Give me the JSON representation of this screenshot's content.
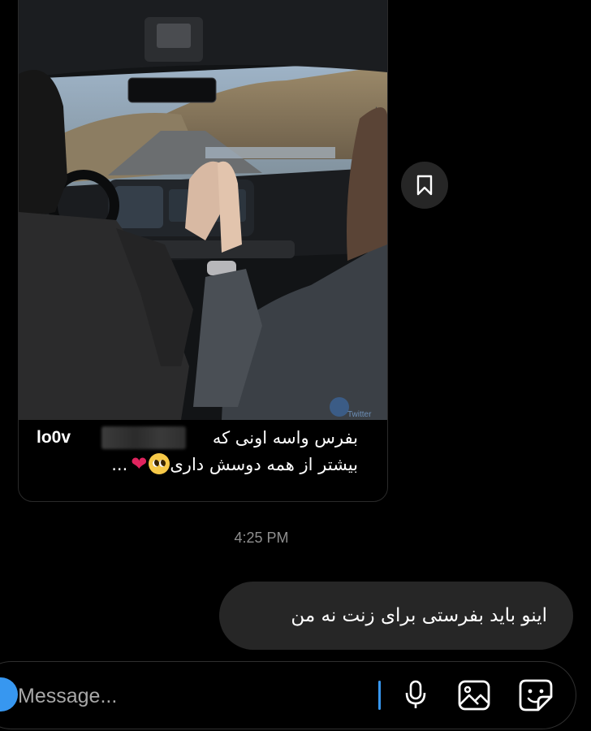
{
  "post": {
    "username": "lo0v",
    "caption_line1": "بفرس واسه اونی که",
    "caption_line2": "بیشتر از همه دوسش داری",
    "ellipsis": "...",
    "heart_emoji": "❤",
    "watermark": "Twitter"
  },
  "timestamp": "4:25 PM",
  "messages": [
    {
      "text": "اینو باید بفرستی برای زنت نه من",
      "sender": "me"
    }
  ],
  "composer": {
    "placeholder": "Message...",
    "icons": [
      "camera-icon",
      "microphone-icon",
      "gallery-icon",
      "sticker-icon"
    ]
  },
  "colors": {
    "accent": "#3797f0",
    "bubble": "#262626",
    "timestamp": "#8e8e8e",
    "heart": "#e0245e"
  }
}
